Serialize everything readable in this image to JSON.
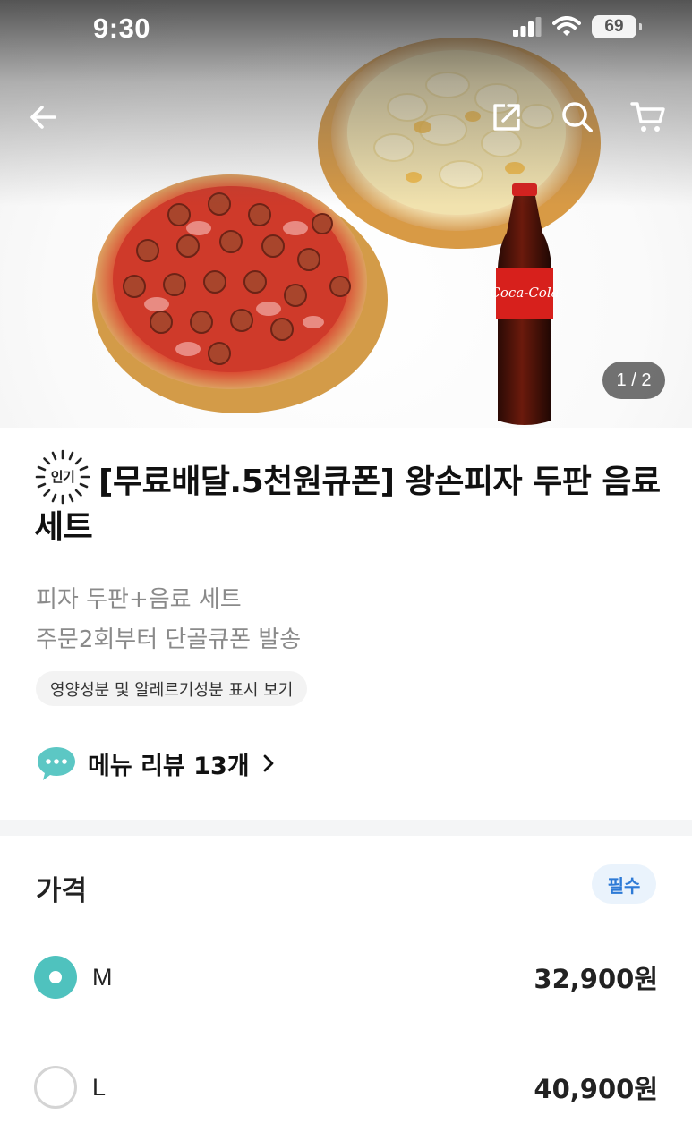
{
  "status_bar": {
    "time": "9:30",
    "battery": "69"
  },
  "hero": {
    "page_indicator": "1 / 2",
    "drink_label": "Coca-Cola"
  },
  "product": {
    "badge": "인기",
    "title": "[무료배달.5천원큐폰] 왕손피자 두판 음료세트",
    "description_lines": [
      "피자 두판+음료 세트",
      "주문2회부터 단골큐폰 발송"
    ],
    "nutrition_link": "영양성분 및 알레르기성분 표시 보기",
    "review_link": "메뉴 리뷰 13개"
  },
  "price_section": {
    "title": "가격",
    "required_label": "필수",
    "options": [
      {
        "name": "M",
        "price": "32,900원",
        "selected": true
      },
      {
        "name": "L",
        "price": "40,900원",
        "selected": false
      }
    ]
  },
  "colors": {
    "accent": "#4fc2be",
    "required_text": "#2d7ad6",
    "required_bg": "#eaf3fc",
    "muted_text": "#8a8a8a"
  },
  "icons": [
    "back-arrow-icon",
    "share-icon",
    "search-icon",
    "cart-icon",
    "chat-bubble-icon",
    "chevron-right-icon",
    "popular-badge-icon"
  ]
}
